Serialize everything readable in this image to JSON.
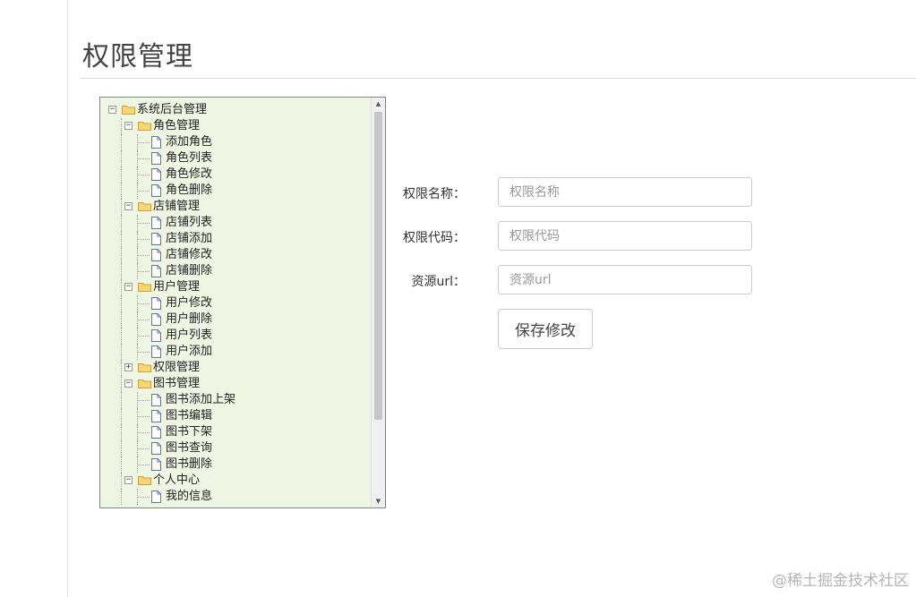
{
  "page": {
    "title": "权限管理"
  },
  "tree": {
    "nodes": [
      {
        "label": "系统后台管理",
        "level": 0,
        "type": "folder",
        "toggle": "minus"
      },
      {
        "label": "角色管理",
        "level": 1,
        "type": "folder",
        "toggle": "minus"
      },
      {
        "label": "添加角色",
        "level": 2,
        "type": "file"
      },
      {
        "label": "角色列表",
        "level": 2,
        "type": "file"
      },
      {
        "label": "角色修改",
        "level": 2,
        "type": "file"
      },
      {
        "label": "角色删除",
        "level": 2,
        "type": "file"
      },
      {
        "label": "店铺管理",
        "level": 1,
        "type": "folder",
        "toggle": "minus"
      },
      {
        "label": "店铺列表",
        "level": 2,
        "type": "file"
      },
      {
        "label": "店铺添加",
        "level": 2,
        "type": "file"
      },
      {
        "label": "店铺修改",
        "level": 2,
        "type": "file"
      },
      {
        "label": "店铺删除",
        "level": 2,
        "type": "file"
      },
      {
        "label": "用户管理",
        "level": 1,
        "type": "folder",
        "toggle": "minus"
      },
      {
        "label": "用户修改",
        "level": 2,
        "type": "file"
      },
      {
        "label": "用户删除",
        "level": 2,
        "type": "file"
      },
      {
        "label": "用户列表",
        "level": 2,
        "type": "file"
      },
      {
        "label": "用户添加",
        "level": 2,
        "type": "file"
      },
      {
        "label": "权限管理",
        "level": 1,
        "type": "folder",
        "toggle": "plus"
      },
      {
        "label": "图书管理",
        "level": 1,
        "type": "folder",
        "toggle": "minus"
      },
      {
        "label": "图书添加上架",
        "level": 2,
        "type": "file"
      },
      {
        "label": "图书编辑",
        "level": 2,
        "type": "file"
      },
      {
        "label": "图书下架",
        "level": 2,
        "type": "file"
      },
      {
        "label": "图书查询",
        "level": 2,
        "type": "file"
      },
      {
        "label": "图书删除",
        "level": 2,
        "type": "file"
      },
      {
        "label": "个人中心",
        "level": 1,
        "type": "folder",
        "toggle": "minus"
      },
      {
        "label": "我的信息",
        "level": 2,
        "type": "file"
      }
    ]
  },
  "form": {
    "name_label": "权限名称：",
    "name_placeholder": "权限名称",
    "code_label": "权限代码：",
    "code_placeholder": "权限代码",
    "url_label": "资源url：",
    "url_placeholder": "资源url",
    "save_label": "保存修改"
  },
  "watermark": "@稀土掘金技术社区",
  "colors": {
    "tree_background": "#f0f6e4",
    "folder": "#f5d77a",
    "border": "#cccccc"
  }
}
